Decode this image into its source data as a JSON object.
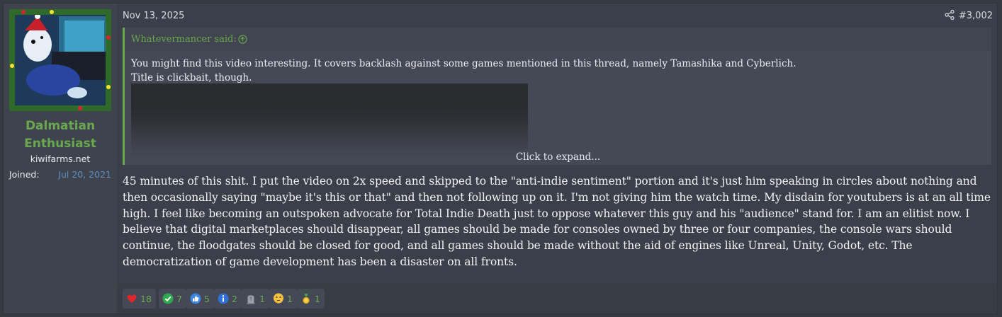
{
  "post": {
    "date": "Nov 13, 2025",
    "number": "#3,002",
    "share_icon": "share-icon"
  },
  "user": {
    "name_line1": "Dalmatian",
    "name_line2": "Enthusiast",
    "title": "kiwifarms.net",
    "joined_label": "Joined:",
    "joined_value": "Jul 20, 2021",
    "name_color": "#6aa84f"
  },
  "quote": {
    "author": "Whatevermancer said:",
    "line1": "You might find this video interesting. It covers backlash against some games mentioned in this thread, namely Tamashika and Cyberlich.",
    "line2": "Title is clickbait, though.",
    "expand_label": "Click to expand..."
  },
  "message": {
    "text": "45 minutes of this shit. I put the video on 2x speed and skipped to the \"anti-indie sentiment\" portion and it's just him speaking in circles about nothing and then occasionally saying \"maybe it's this or that\" and then not following up on it. I'm not giving him the watch time. My disdain for youtubers is at an all time high. I feel like becoming an outspoken advocate for Total Indie Death just to oppose whatever this guy and his \"audience\" stand for. I am an elitist now. I believe that digital marketplaces should disappear, all games should be made for consoles owned by three or four companies, the console wars should continue, the floodgates should be closed for good, and all games should be made without the aid of engines like Unreal, Unity, Godot, etc. The democratization of game development has been a disaster on all fronts."
  },
  "reactions": [
    {
      "icon": "heart-icon",
      "count": "18"
    },
    {
      "icon": "checkmark-icon",
      "count": "7"
    },
    {
      "icon": "thumbs-up-icon",
      "count": "5"
    },
    {
      "icon": "info-icon",
      "count": "2"
    },
    {
      "icon": "tombstone-icon",
      "count": "1"
    },
    {
      "icon": "thinking-face-icon",
      "count": "1"
    },
    {
      "icon": "medal-icon",
      "count": "1"
    }
  ],
  "colors": {
    "accent": "#6aa84f",
    "link": "#5f8ebf",
    "background": "#3b3f49"
  }
}
